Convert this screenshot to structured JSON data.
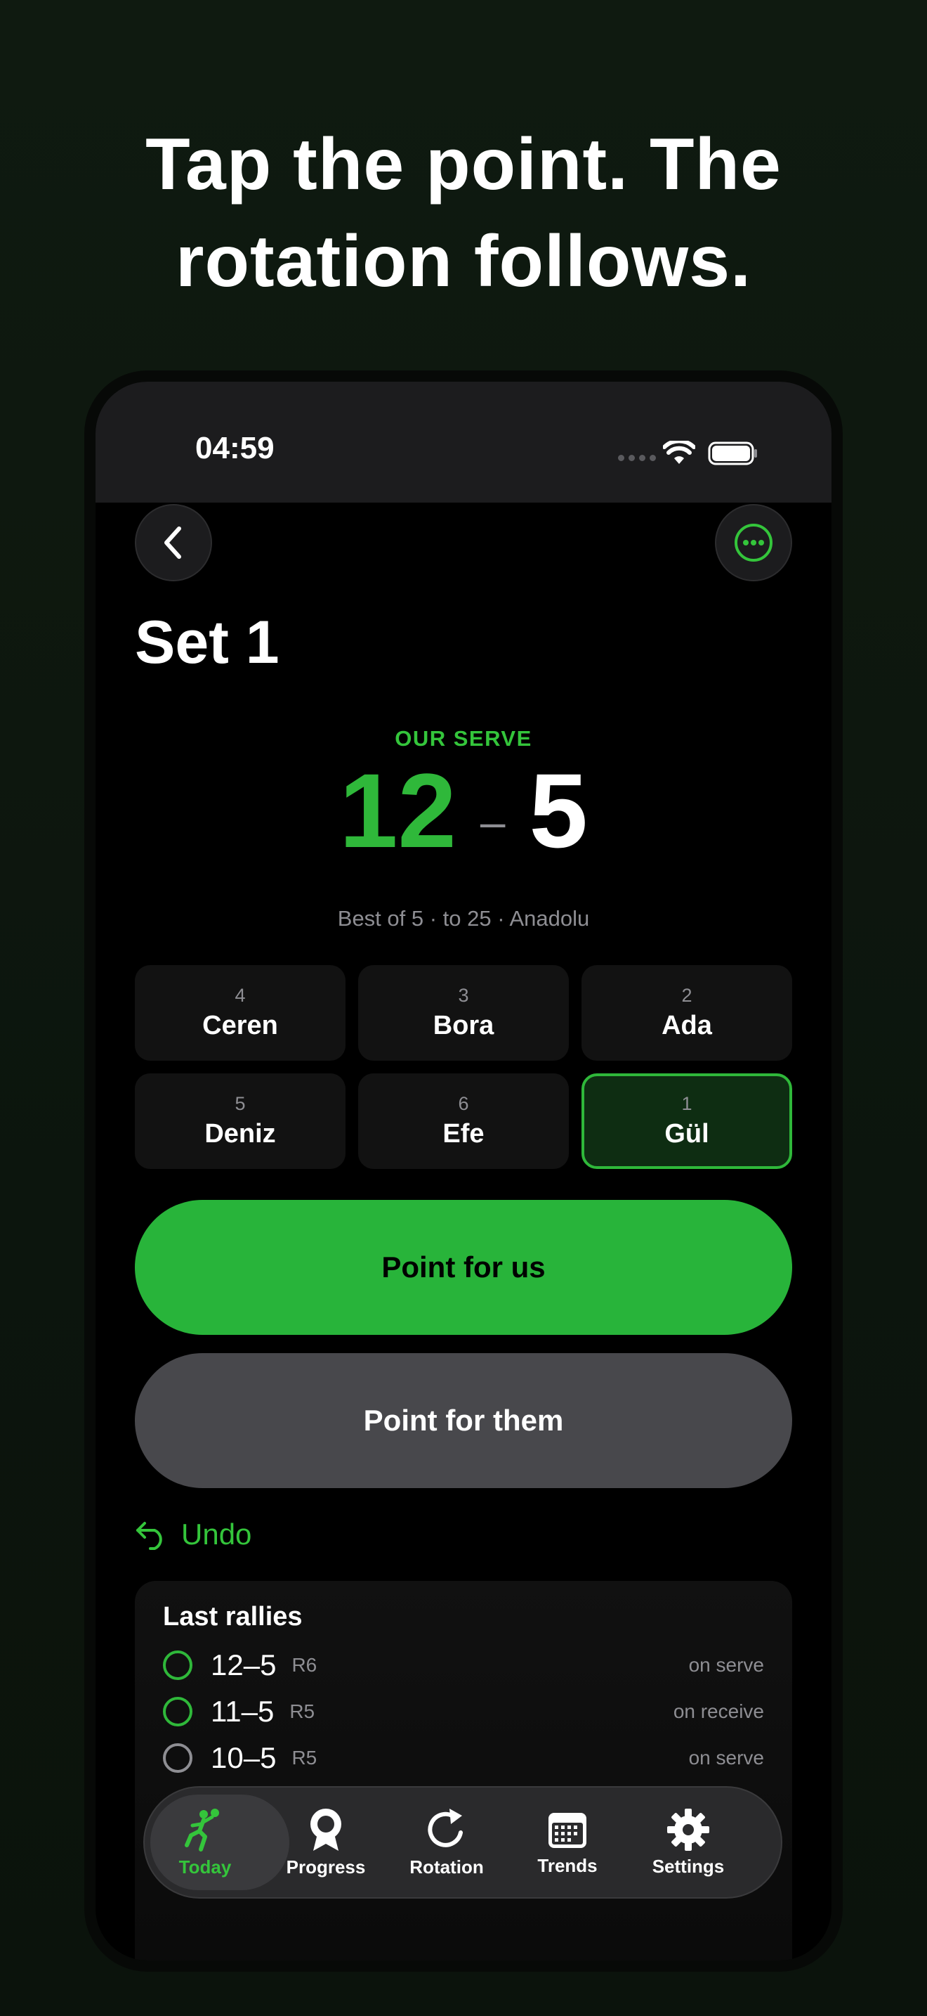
{
  "headline": {
    "line1": "Tap the point. The",
    "line2": "rotation follows."
  },
  "status_bar": {
    "time": "04:59"
  },
  "nav": {
    "back_icon": "chevron-left-icon",
    "more_icon": "ellipsis-circle-icon"
  },
  "page": {
    "title": "Set 1"
  },
  "score": {
    "serve_label": "OUR SERVE",
    "us": "12",
    "separator": "–",
    "them": "5",
    "meta": "Best of 5 · to 25 · Anadolu"
  },
  "positions": [
    {
      "num": "4",
      "name": "Ceren",
      "active": false
    },
    {
      "num": "3",
      "name": "Bora",
      "active": false
    },
    {
      "num": "2",
      "name": "Ada",
      "active": false
    },
    {
      "num": "5",
      "name": "Deniz",
      "active": false
    },
    {
      "num": "6",
      "name": "Efe",
      "active": false
    },
    {
      "num": "1",
      "name": "Gül",
      "active": true
    }
  ],
  "actions": {
    "point_us": "Point for us",
    "point_them": "Point for them",
    "undo": "Undo"
  },
  "rallies": {
    "title": "Last rallies",
    "items": [
      {
        "score": "12–5",
        "rotation": "R6",
        "phase": "on serve",
        "winner": "us"
      },
      {
        "score": "11–5",
        "rotation": "R5",
        "phase": "on receive",
        "winner": "us"
      },
      {
        "score": "10–5",
        "rotation": "R5",
        "phase": "on serve",
        "winner": "them"
      }
    ]
  },
  "tabs": [
    {
      "label": "Today",
      "icon": "volleyball-player-icon",
      "active": true
    },
    {
      "label": "Progress",
      "icon": "award-ribbon-icon",
      "active": false
    },
    {
      "label": "Rotation",
      "icon": "rotate-arrow-icon",
      "active": false
    },
    {
      "label": "Trends",
      "icon": "calendar-icon",
      "active": false
    },
    {
      "label": "Settings",
      "icon": "gear-icon",
      "active": false
    }
  ],
  "colors": {
    "accent": "#2fb83a",
    "background": "#0f1a10",
    "secondary_button": "#48484c"
  }
}
